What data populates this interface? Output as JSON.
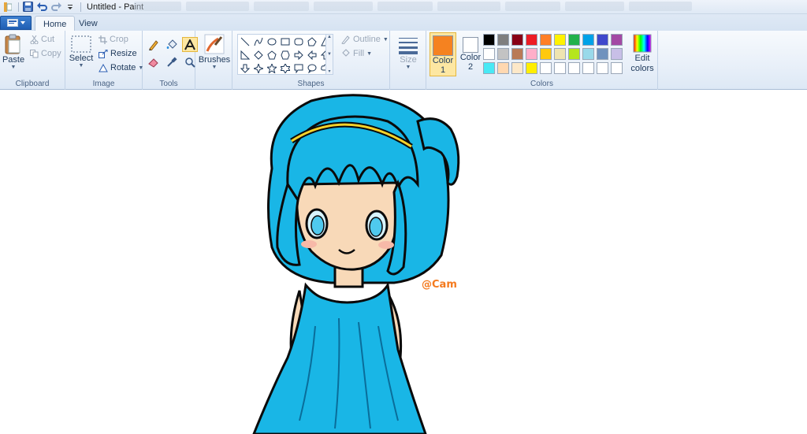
{
  "window": {
    "title": "Untitled - Paint"
  },
  "tabs": [
    {
      "label": "Home"
    },
    {
      "label": "View"
    }
  ],
  "ribbon": {
    "clipboard": {
      "label": "Clipboard",
      "paste": "Paste",
      "cut": "Cut",
      "copy": "Copy"
    },
    "image": {
      "label": "Image",
      "select": "Select",
      "crop": "Crop",
      "resize": "Resize",
      "rotate": "Rotate"
    },
    "tools": {
      "label": "Tools"
    },
    "brushes": {
      "label": "Brushes"
    },
    "shapes": {
      "label": "Shapes",
      "outline": "Outline",
      "fill": "Fill"
    },
    "size": {
      "label": "Size"
    },
    "colors": {
      "label": "Colors",
      "color1_label": "Color",
      "color1_num": "1",
      "color2_label": "Color",
      "color2_num": "2",
      "edit_label": "Edit",
      "edit_label2": "colors",
      "color1_value": "#f58220",
      "color2_value": "#ffffff",
      "palette": [
        "#000000",
        "#7f7f7f",
        "#880015",
        "#ed1c24",
        "#ff7f27",
        "#fff200",
        "#22b14c",
        "#00a2e8",
        "#3f48cc",
        "#a349a4",
        "#ffffff",
        "#c3c3c3",
        "#b97a57",
        "#ffaec9",
        "#ffc90e",
        "#efe4b0",
        "#b5e61d",
        "#99d9ea",
        "#7092be",
        "#c8bfe7",
        "#49e9f5",
        "#ffd8b1",
        "#fde8c8",
        "#ffee00",
        "#ffffff",
        "#ffffff",
        "#ffffff",
        "#ffffff",
        "#ffffff",
        "#ffffff"
      ]
    }
  },
  "canvas": {
    "signature": "@Cam"
  }
}
